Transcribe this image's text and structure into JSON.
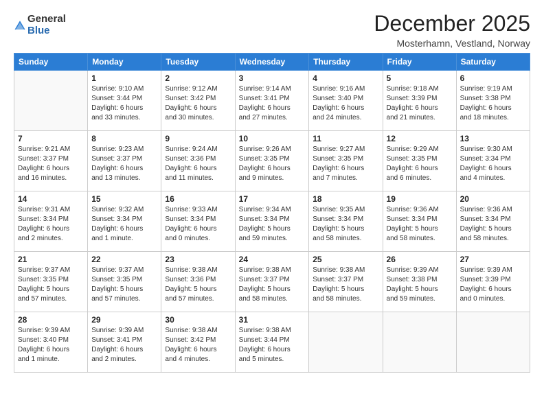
{
  "logo": {
    "general": "General",
    "blue": "Blue"
  },
  "title": "December 2025",
  "subtitle": "Mosterhamn, Vestland, Norway",
  "days_of_week": [
    "Sunday",
    "Monday",
    "Tuesday",
    "Wednesday",
    "Thursday",
    "Friday",
    "Saturday"
  ],
  "weeks": [
    [
      {
        "day": "",
        "info": ""
      },
      {
        "day": "1",
        "info": "Sunrise: 9:10 AM\nSunset: 3:44 PM\nDaylight: 6 hours\nand 33 minutes."
      },
      {
        "day": "2",
        "info": "Sunrise: 9:12 AM\nSunset: 3:42 PM\nDaylight: 6 hours\nand 30 minutes."
      },
      {
        "day": "3",
        "info": "Sunrise: 9:14 AM\nSunset: 3:41 PM\nDaylight: 6 hours\nand 27 minutes."
      },
      {
        "day": "4",
        "info": "Sunrise: 9:16 AM\nSunset: 3:40 PM\nDaylight: 6 hours\nand 24 minutes."
      },
      {
        "day": "5",
        "info": "Sunrise: 9:18 AM\nSunset: 3:39 PM\nDaylight: 6 hours\nand 21 minutes."
      },
      {
        "day": "6",
        "info": "Sunrise: 9:19 AM\nSunset: 3:38 PM\nDaylight: 6 hours\nand 18 minutes."
      }
    ],
    [
      {
        "day": "7",
        "info": "Sunrise: 9:21 AM\nSunset: 3:37 PM\nDaylight: 6 hours\nand 16 minutes."
      },
      {
        "day": "8",
        "info": "Sunrise: 9:23 AM\nSunset: 3:37 PM\nDaylight: 6 hours\nand 13 minutes."
      },
      {
        "day": "9",
        "info": "Sunrise: 9:24 AM\nSunset: 3:36 PM\nDaylight: 6 hours\nand 11 minutes."
      },
      {
        "day": "10",
        "info": "Sunrise: 9:26 AM\nSunset: 3:35 PM\nDaylight: 6 hours\nand 9 minutes."
      },
      {
        "day": "11",
        "info": "Sunrise: 9:27 AM\nSunset: 3:35 PM\nDaylight: 6 hours\nand 7 minutes."
      },
      {
        "day": "12",
        "info": "Sunrise: 9:29 AM\nSunset: 3:35 PM\nDaylight: 6 hours\nand 6 minutes."
      },
      {
        "day": "13",
        "info": "Sunrise: 9:30 AM\nSunset: 3:34 PM\nDaylight: 6 hours\nand 4 minutes."
      }
    ],
    [
      {
        "day": "14",
        "info": "Sunrise: 9:31 AM\nSunset: 3:34 PM\nDaylight: 6 hours\nand 2 minutes."
      },
      {
        "day": "15",
        "info": "Sunrise: 9:32 AM\nSunset: 3:34 PM\nDaylight: 6 hours\nand 1 minute."
      },
      {
        "day": "16",
        "info": "Sunrise: 9:33 AM\nSunset: 3:34 PM\nDaylight: 6 hours\nand 0 minutes."
      },
      {
        "day": "17",
        "info": "Sunrise: 9:34 AM\nSunset: 3:34 PM\nDaylight: 5 hours\nand 59 minutes."
      },
      {
        "day": "18",
        "info": "Sunrise: 9:35 AM\nSunset: 3:34 PM\nDaylight: 5 hours\nand 58 minutes."
      },
      {
        "day": "19",
        "info": "Sunrise: 9:36 AM\nSunset: 3:34 PM\nDaylight: 5 hours\nand 58 minutes."
      },
      {
        "day": "20",
        "info": "Sunrise: 9:36 AM\nSunset: 3:34 PM\nDaylight: 5 hours\nand 58 minutes."
      }
    ],
    [
      {
        "day": "21",
        "info": "Sunrise: 9:37 AM\nSunset: 3:35 PM\nDaylight: 5 hours\nand 57 minutes."
      },
      {
        "day": "22",
        "info": "Sunrise: 9:37 AM\nSunset: 3:35 PM\nDaylight: 5 hours\nand 57 minutes."
      },
      {
        "day": "23",
        "info": "Sunrise: 9:38 AM\nSunset: 3:36 PM\nDaylight: 5 hours\nand 57 minutes."
      },
      {
        "day": "24",
        "info": "Sunrise: 9:38 AM\nSunset: 3:37 PM\nDaylight: 5 hours\nand 58 minutes."
      },
      {
        "day": "25",
        "info": "Sunrise: 9:38 AM\nSunset: 3:37 PM\nDaylight: 5 hours\nand 58 minutes."
      },
      {
        "day": "26",
        "info": "Sunrise: 9:39 AM\nSunset: 3:38 PM\nDaylight: 5 hours\nand 59 minutes."
      },
      {
        "day": "27",
        "info": "Sunrise: 9:39 AM\nSunset: 3:39 PM\nDaylight: 6 hours\nand 0 minutes."
      }
    ],
    [
      {
        "day": "28",
        "info": "Sunrise: 9:39 AM\nSunset: 3:40 PM\nDaylight: 6 hours\nand 1 minute."
      },
      {
        "day": "29",
        "info": "Sunrise: 9:39 AM\nSunset: 3:41 PM\nDaylight: 6 hours\nand 2 minutes."
      },
      {
        "day": "30",
        "info": "Sunrise: 9:38 AM\nSunset: 3:42 PM\nDaylight: 6 hours\nand 4 minutes."
      },
      {
        "day": "31",
        "info": "Sunrise: 9:38 AM\nSunset: 3:44 PM\nDaylight: 6 hours\nand 5 minutes."
      },
      {
        "day": "",
        "info": ""
      },
      {
        "day": "",
        "info": ""
      },
      {
        "day": "",
        "info": ""
      }
    ]
  ]
}
